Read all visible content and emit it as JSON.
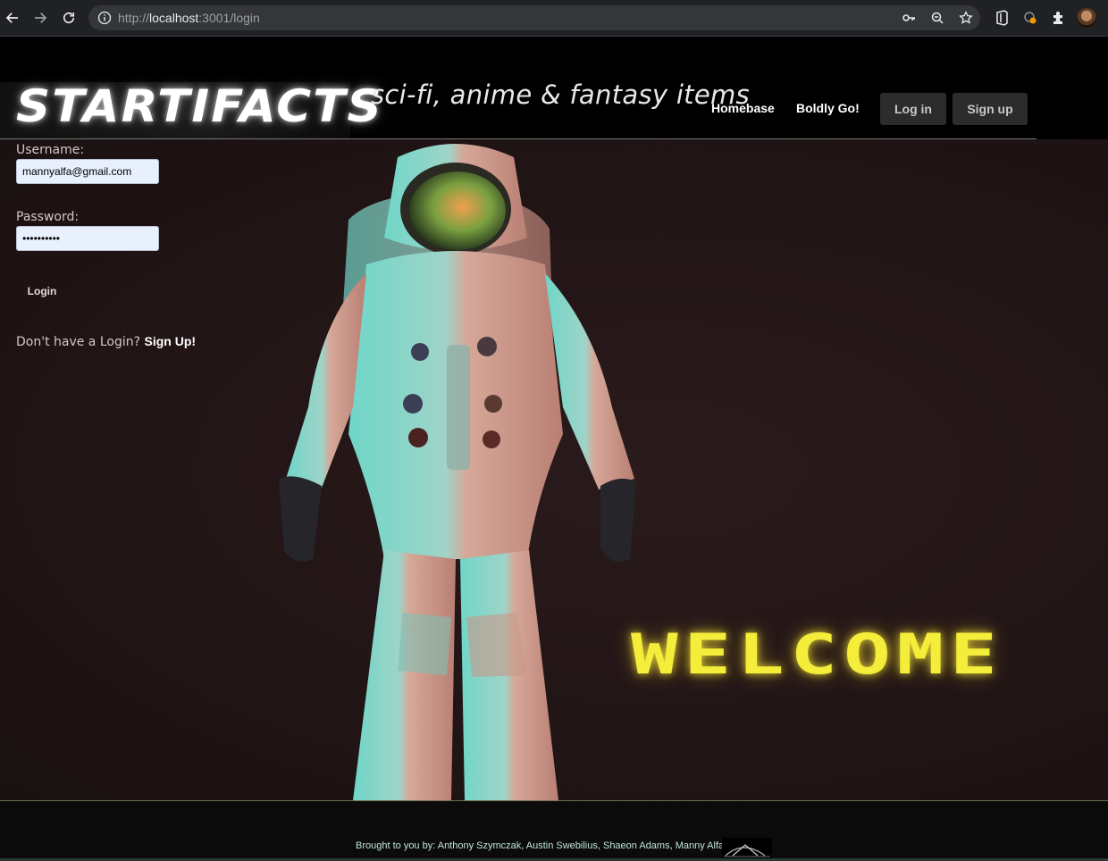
{
  "browser": {
    "url_prefix": "http://",
    "url_host": "localhost",
    "url_suffix": ":3001/login"
  },
  "header": {
    "logo": "STARTIFACTS",
    "tagline": "sci-fi, anime & fantasy items",
    "nav": {
      "homebase": "Homebase",
      "boldly_go": "Boldly Go!",
      "log_in": "Log in",
      "sign_up": "Sign up"
    }
  },
  "login_form": {
    "username_label": "Username:",
    "username_value": "mannyalfa@gmail.com",
    "password_label": "Password:",
    "password_value": "••••••••••",
    "submit_label": "Login",
    "signup_prompt": "Don't have a Login?",
    "signup_link": "Sign Up!"
  },
  "hero": {
    "welcome_text": "WELCOME"
  },
  "footer": {
    "credits": "Brought to you by: Anthony Szymczak, Austin Swebilius, Shaeon Adams, Manny Alfaro"
  },
  "colors": {
    "welcome": "#f4ee3a",
    "background": "#221516",
    "input_bg": "#e8f0fe"
  }
}
